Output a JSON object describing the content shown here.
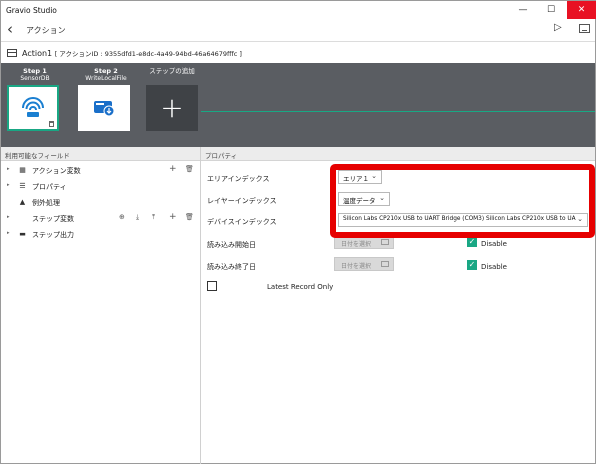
{
  "window": {
    "title": "Gravio Studio",
    "controls": {
      "minimize": "—",
      "maximize": "☐",
      "close": "✕"
    }
  },
  "header": {
    "back_glyph": "‹",
    "title": "アクション",
    "run_glyph": "▷"
  },
  "action": {
    "name": "Action1",
    "id_text": "[ アクションID : 9355dfd1-e8dc-4a49-94bd-46a64679fffc ]"
  },
  "steps": [
    {
      "title": "Step 1",
      "subtitle": "SensorDB"
    },
    {
      "title": "Step 2",
      "subtitle": "WriteLocalFile"
    }
  ],
  "add_step": {
    "label": "ステップの追加",
    "glyph": "+"
  },
  "left_panel": {
    "header": "利用可能なフィールド",
    "items": [
      {
        "label": "アクション変数",
        "icon": "table-icon",
        "glyph": "▦"
      },
      {
        "label": "プロパティ",
        "icon": "list-icon",
        "glyph": "☰"
      },
      {
        "label": "例外処理",
        "icon": "warning-icon",
        "glyph": "▲"
      },
      {
        "label": "ステップ変数",
        "icon": "",
        "glyph": ""
      },
      {
        "label": "ステップ出力",
        "icon": "output-icon",
        "glyph": "▬"
      }
    ],
    "expand_glyph": "▸",
    "add_glyph": "+",
    "delete_glyph": "🗑"
  },
  "properties": {
    "header": "プロパティ",
    "area_index": {
      "label": "エリアインデックス",
      "value": "エリア１"
    },
    "layer_index": {
      "label": "レイヤーインデックス",
      "value": "温度データ"
    },
    "device_index": {
      "label": "デバイスインデックス",
      "value": "Silicon Labs CP210x USB to UART Bridge (COM3) Silicon Labs CP210x USB to UA"
    },
    "read_start": {
      "label": "読み込み開始日",
      "placeholder": "日付を選択",
      "disable_label": "Disable",
      "checked": true
    },
    "read_end": {
      "label": "読み込み終了日",
      "placeholder": "日付を選択",
      "disable_label": "Disable",
      "checked": true
    },
    "latest_only": {
      "label": "Latest Record Only",
      "checked": false
    },
    "chevron_glyph": "⌄",
    "check_glyph": "✓"
  },
  "colors": {
    "accent": "#19a784",
    "highlight": "#e60000",
    "steps_bg": "#5a5d62"
  }
}
